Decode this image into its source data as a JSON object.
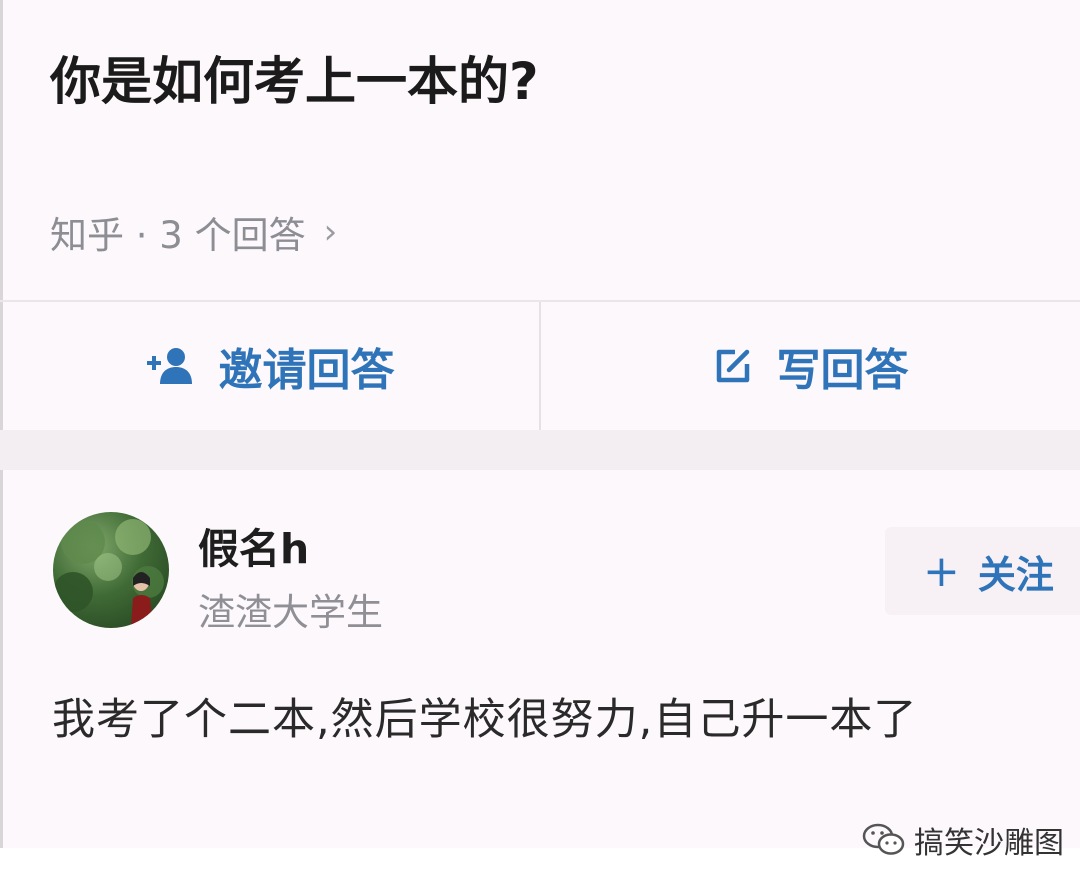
{
  "question": {
    "title": "你是如何考上一本的?",
    "meta": "知乎 · 3 个回答",
    "meta_chevron": "›"
  },
  "actions": {
    "invite": {
      "icon": "add-user-icon",
      "label": "邀请回答"
    },
    "write": {
      "icon": "edit-icon",
      "label": "写回答"
    }
  },
  "answer": {
    "author_name": "假名h",
    "author_bio": "渣渣大学生",
    "follow_plus": "+",
    "follow_label": "关注",
    "text": "我考了个二本,然后学校很努力,自己升一本了"
  },
  "watermark": {
    "icon": "wechat-icon",
    "text": "搞笑沙雕图"
  },
  "colors": {
    "accent": "#2f74b8",
    "background": "#fcf8fb",
    "title": "#1b1b1b",
    "muted": "#8d8d94"
  }
}
